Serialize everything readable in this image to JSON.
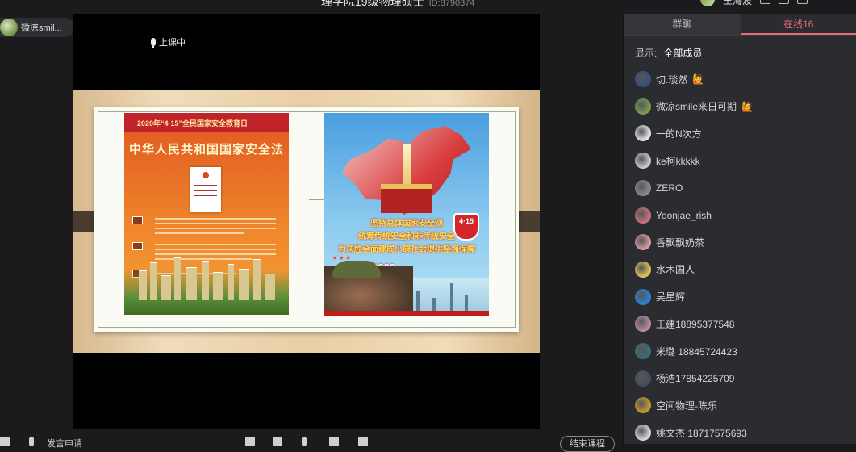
{
  "window": {
    "title": "理学院19级物理硕士",
    "room_id": "ID:8790374",
    "host_name": "王海波"
  },
  "stage": {
    "presenter_name": "微凉smil...",
    "status_label": "上课中"
  },
  "slide": {
    "left_poster": {
      "header": "2020年“4·15”全民国家安全教育日",
      "title": "中华人民共和国国家安全法"
    },
    "right_poster": {
      "line1": "坚持总体国家安全观",
      "line2": "统筹传统安全和非传统安全",
      "line3": "为决胜全面建成小康社会提供坚强保障",
      "badge": "4·15",
      "hotline": "12339"
    }
  },
  "bottom_bar": {
    "speak_request": "发言申请",
    "end_class": "结束课程"
  },
  "panel": {
    "tabs": [
      {
        "label": "群聊"
      },
      {
        "label": "在线16"
      }
    ],
    "filter_label": "显示:",
    "filter_value": "全部成员",
    "members": [
      {
        "name": "切.琰然",
        "tag": "🙋",
        "color": "#39507a"
      },
      {
        "name": "微凉smile来日可期",
        "tag": "🙋",
        "color": "#7a9b52"
      },
      {
        "name": "一的N次方",
        "tag": "",
        "color": "#e6e6e6"
      },
      {
        "name": "ke柯kkkkk",
        "tag": "",
        "color": "#c8c8c8"
      },
      {
        "name": "ZERO",
        "tag": "",
        "color": "#8a8a8a"
      },
      {
        "name": "Yoonjae_rish",
        "tag": "",
        "color": "#c9707e"
      },
      {
        "name": "香飘飘奶茶",
        "tag": "",
        "color": "#d99aa0"
      },
      {
        "name": "水木国人",
        "tag": "",
        "color": "#d9c25a"
      },
      {
        "name": "吴星辉",
        "tag": "",
        "color": "#2d7fd6"
      },
      {
        "name": "王建18895377548",
        "tag": "",
        "color": "#b98aa5"
      },
      {
        "name": "米璐 18845724423",
        "tag": "",
        "color": "#3a6d7a"
      },
      {
        "name": "杨浩17854225709",
        "tag": "",
        "color": "#444c5c"
      },
      {
        "name": "空间物理-陈乐",
        "tag": "",
        "color": "#c79a2a"
      },
      {
        "name": "姚文杰 18717575693",
        "tag": "",
        "color": "#d6d6d6"
      }
    ]
  }
}
